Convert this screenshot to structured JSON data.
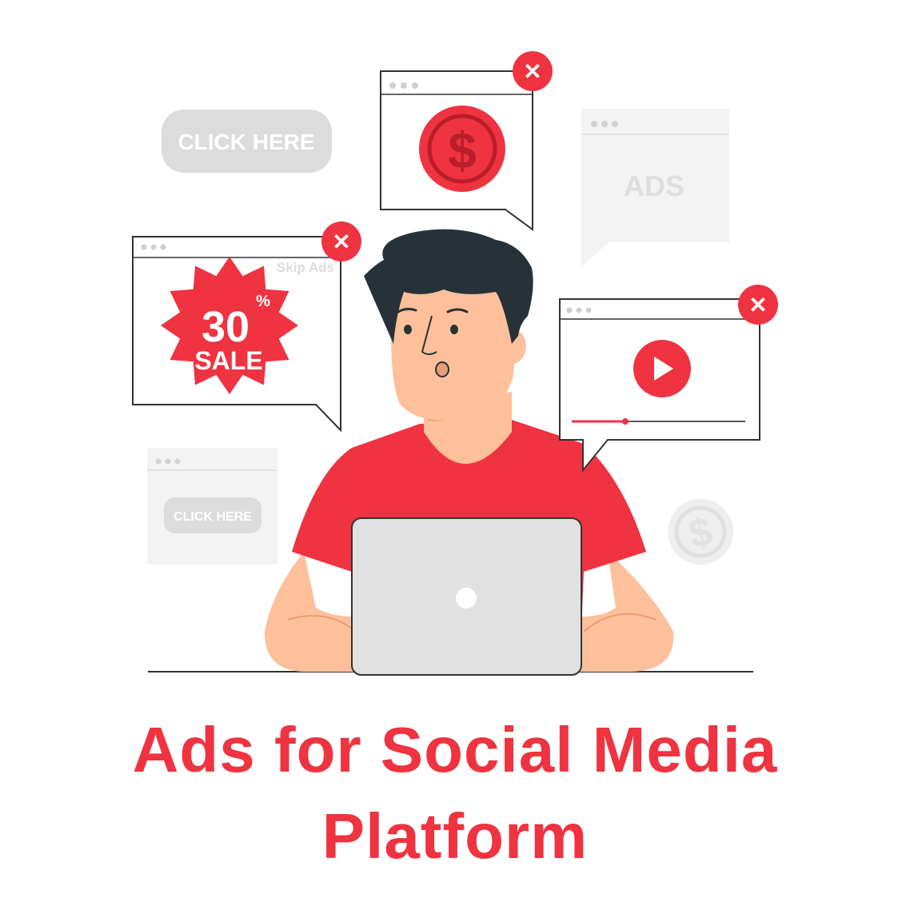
{
  "title": {
    "line1": "Ads for Social Media",
    "line2": "Platform"
  },
  "ads": {
    "click_here_large": "CLICK HERE",
    "click_here_small": "CLICK HERE",
    "ads_label": "ADS",
    "skip_ads": "Skip Ads",
    "sale_percent": "30",
    "sale_percent_sign": "%",
    "sale_word": "SALE",
    "dollar_symbol": "$",
    "close_symbol": "✕"
  },
  "colors": {
    "accent": "#ef3340",
    "dark_red": "#b81f29",
    "grey_ad": "#dcdcdc",
    "grey_panel": "#f3f3f3",
    "skin": "#fdc09a",
    "hair": "#263238",
    "laptop": "#e1e1e1"
  },
  "icons": [
    "close-icon",
    "dollar-coin-icon",
    "play-icon",
    "sale-badge-icon",
    "window-dots-icon"
  ]
}
